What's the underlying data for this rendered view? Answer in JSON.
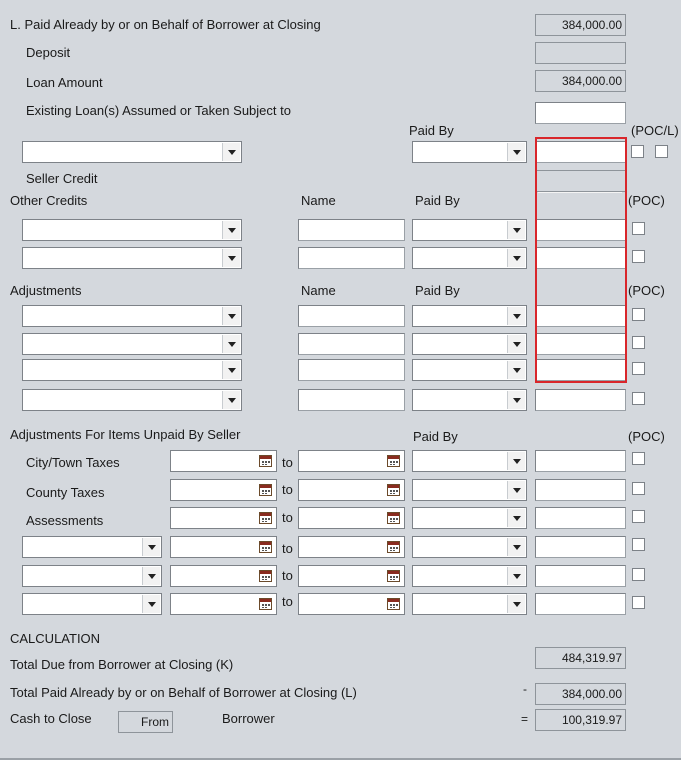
{
  "section_l": {
    "title": "L. Paid Already by or on Behalf of Borrower at Closing",
    "total": "384,000.00",
    "deposit_label": "Deposit",
    "deposit_value": "",
    "loan_amount_label": "Loan Amount",
    "loan_amount_value": "384,000.00",
    "existing_loans_label": "Existing Loan(s) Assumed or Taken Subject to",
    "paid_by_header": "Paid By",
    "poc_l_header": "(POC/L)",
    "seller_credit_label": "Seller Credit"
  },
  "other_credits": {
    "label": "Other Credits",
    "name_header": "Name",
    "paid_by_header": "Paid By",
    "poc_header": "(POC)"
  },
  "adjustments": {
    "label": "Adjustments",
    "name_header": "Name",
    "paid_by_header": "Paid By",
    "poc_header": "(POC)"
  },
  "unpaid_by_seller": {
    "label": "Adjustments For Items Unpaid By Seller",
    "paid_by_header": "Paid By",
    "poc_header": "(POC)",
    "to_label": "to",
    "rows": [
      {
        "label": "City/Town Taxes"
      },
      {
        "label": "County Taxes"
      },
      {
        "label": "Assessments"
      }
    ]
  },
  "calculation": {
    "title": "CALCULATION",
    "total_due_label": "Total Due from Borrower at Closing (K)",
    "total_due_value": "484,319.97",
    "total_paid_label": "Total Paid Already by or on Behalf of Borrower at Closing (L)",
    "minus_sign": "-",
    "total_paid_value": "384,000.00",
    "cash_to_close_label": "Cash to Close",
    "from_value": "From",
    "borrower_label": "Borrower",
    "equals_sign": "=",
    "cash_value": "100,319.97"
  },
  "highlight_color": "#d9262b"
}
